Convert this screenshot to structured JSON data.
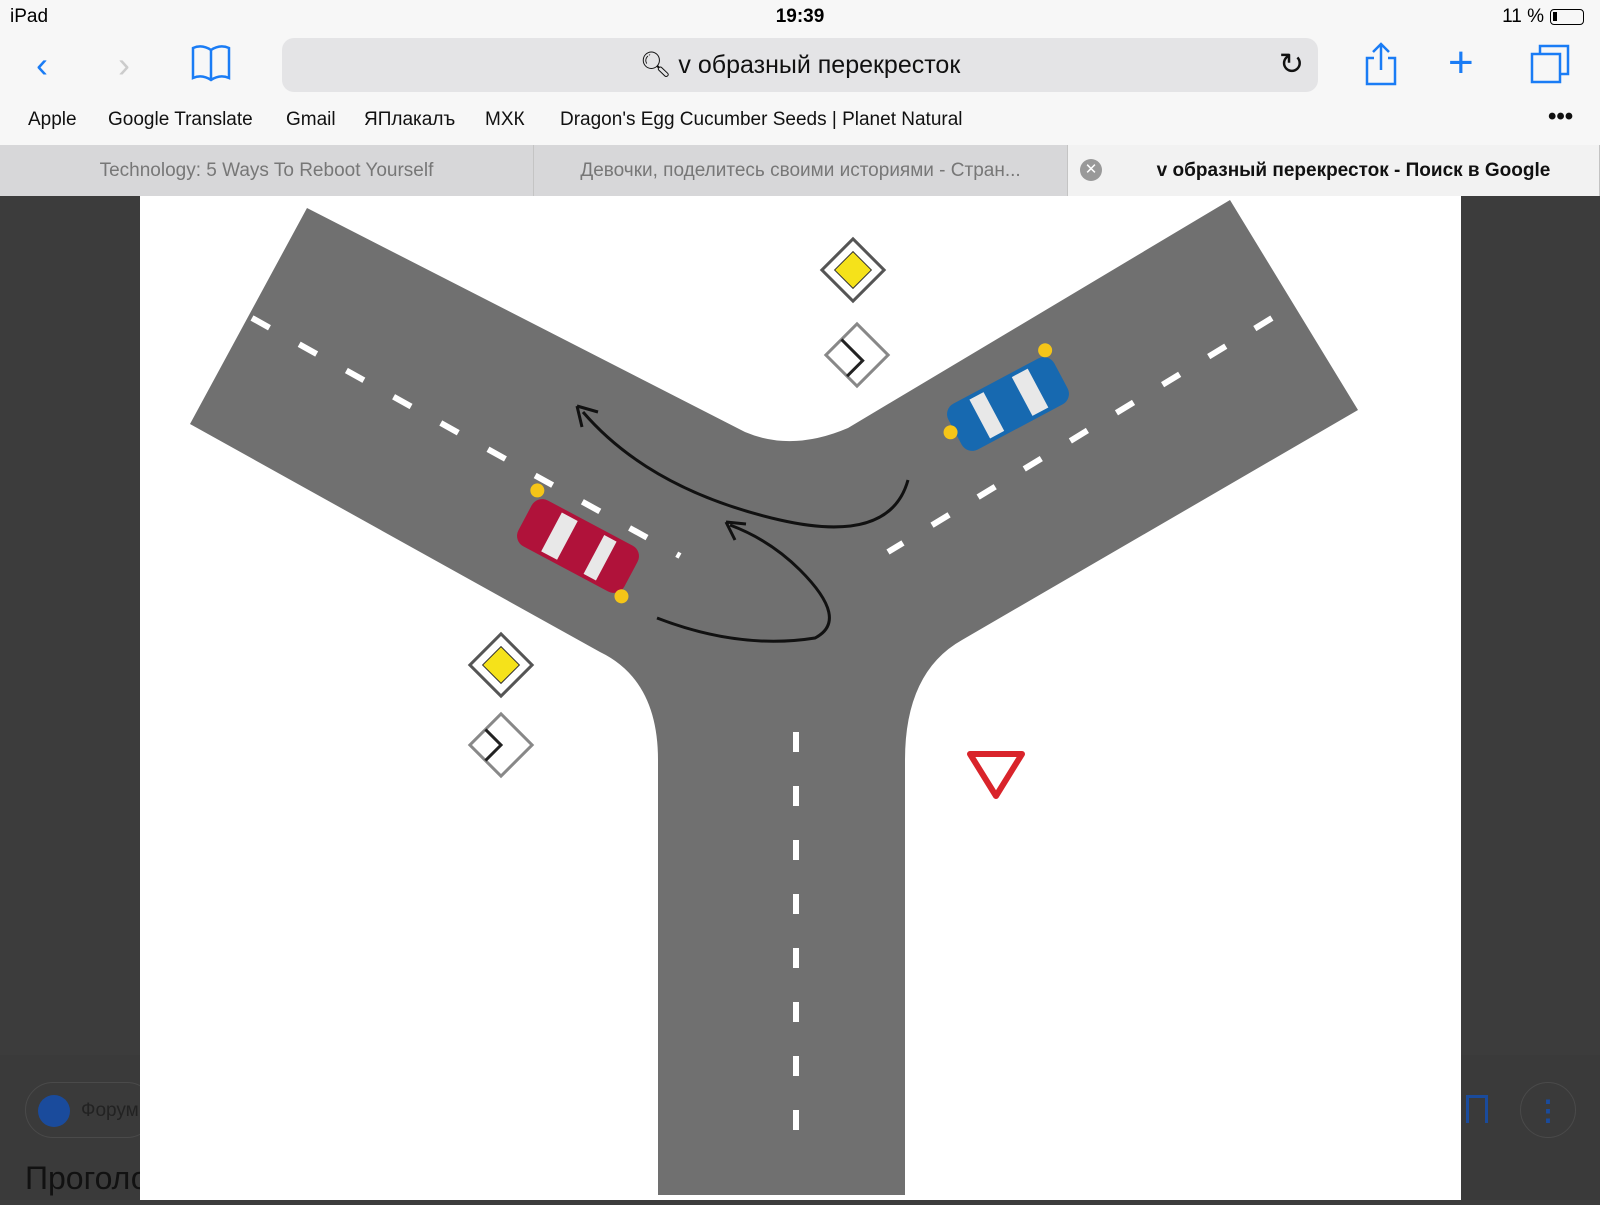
{
  "status": {
    "device": "iPad",
    "time": "19:39",
    "battery": "11 %"
  },
  "toolbar": {
    "url": "v образный перекресток",
    "icons": [
      "back-icon",
      "forward-icon",
      "bookmarks-icon",
      "search-icon",
      "reload-icon",
      "share-icon",
      "new-tab-icon",
      "tabs-icon"
    ]
  },
  "bookmarks": [
    "Apple",
    "Google Translate",
    "Gmail",
    "ЯПлакалъ",
    "МХК",
    "Dragon's Egg Cucumber Seeds | Planet Natural"
  ],
  "tabs": [
    {
      "label": "Technology: 5 Ways To Reboot Yourself"
    },
    {
      "label": "Девочки, поделитесь своими историями - Стран..."
    },
    {
      "label": "v образный перекресток - Поиск в Google",
      "active": true
    }
  ],
  "under": {
    "source": "Форум",
    "heading": "Проголо"
  },
  "colors": {
    "accent": "#1a7cf5",
    "road": "#6f6f6f",
    "red_car": "#b0123a",
    "blue_car": "#1769b0",
    "sign_yellow": "#f5e21a",
    "yield_red": "#d9242b"
  }
}
